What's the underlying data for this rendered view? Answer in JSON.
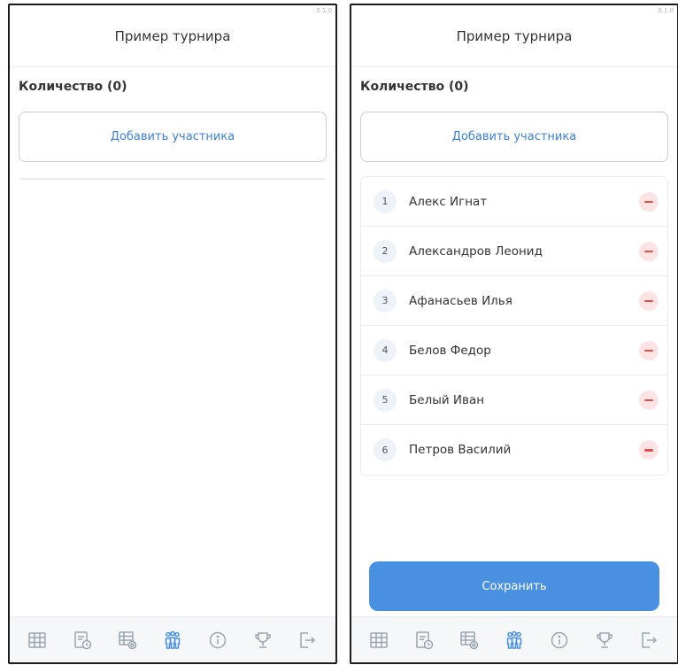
{
  "colors": {
    "accent": "#4a90e0",
    "link": "#3f7fd2",
    "remove_bg": "#fde4e4",
    "remove_fg": "#e24c4c",
    "tab_inactive": "#9aa5b1",
    "tab_active": "#4a90e0"
  },
  "tabbar": {
    "icons": [
      "table-icon",
      "clock-document-icon",
      "settings-table-icon",
      "participants-icon",
      "info-icon",
      "trophy-icon",
      "logout-icon"
    ],
    "active": "participants-icon"
  },
  "left_screen": {
    "version": "0.1.0",
    "title": "Пример турнира",
    "count_label": "Количество (0)",
    "add_button": "Добавить участника"
  },
  "right_screen": {
    "version": "0.1.0",
    "title": "Пример турнира",
    "count_label": "Количество (0)",
    "add_button": "Добавить участника",
    "participants": [
      {
        "num": "1",
        "name": "Алекс Игнат"
      },
      {
        "num": "2",
        "name": "Александров Леонид"
      },
      {
        "num": "3",
        "name": "Афанасьев Илья"
      },
      {
        "num": "4",
        "name": "Белов Федор"
      },
      {
        "num": "5",
        "name": "Белый Иван"
      },
      {
        "num": "6",
        "name": "Петров Василий"
      }
    ],
    "save_button": "Сохранить"
  }
}
